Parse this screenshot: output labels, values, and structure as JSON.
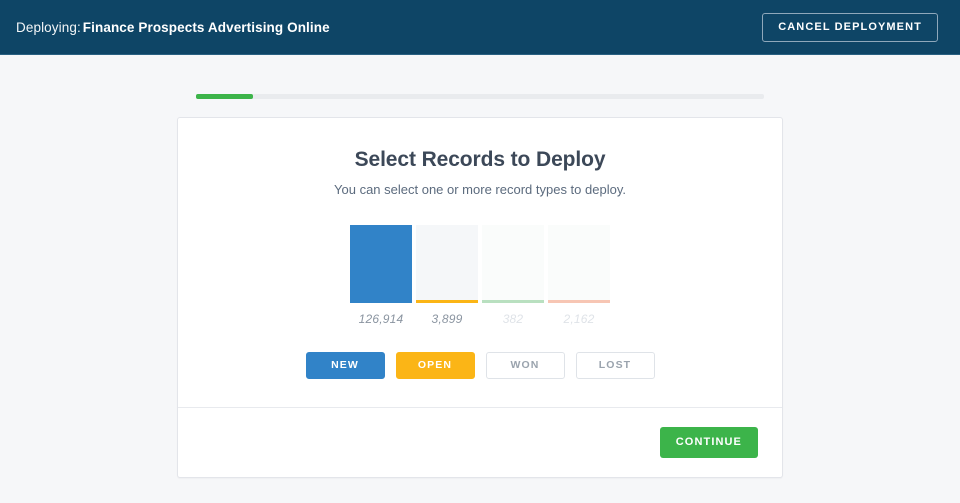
{
  "header": {
    "deploying_label": "Deploying:",
    "deployment_name": "Finance Prospects Advertising Online",
    "cancel_label": "CANCEL DEPLOYMENT",
    "background_color": "#0e4566"
  },
  "progress": {
    "percent": 10,
    "fill_color": "#3cb44a",
    "track_color": "#e9ebee"
  },
  "card": {
    "title": "Select Records to Deploy",
    "subtitle": "You can select one or more record types to deploy.",
    "continue_label": "CONTINUE",
    "continue_color": "#3cb44a"
  },
  "chart_data": {
    "type": "bar",
    "title": "Select Records to Deploy",
    "xlabel": "",
    "ylabel": "",
    "categories": [
      "NEW",
      "OPEN",
      "WON",
      "LOST"
    ],
    "values": [
      126914,
      3899,
      382,
      2162
    ],
    "value_labels": [
      "126,914",
      "3,899",
      "382",
      "2,162"
    ],
    "ylim": [
      0,
      126914
    ],
    "grid": false,
    "legend": "none",
    "bar_colors": [
      "#3183c8",
      "#fbb516",
      "#b9e0c0",
      "#f7c6b4"
    ],
    "bar_track_colors": [
      "#f5f7f9",
      "#f5f7f9",
      "#fafcfb",
      "#fafcfb"
    ],
    "selected": [
      true,
      true,
      false,
      false
    ]
  },
  "record_types": [
    {
      "label": "NEW",
      "count_label": "126,914",
      "selected": true,
      "state": "new-sel",
      "label_tone": "on"
    },
    {
      "label": "OPEN",
      "count_label": "3,899",
      "selected": true,
      "state": "open-sel",
      "label_tone": "on"
    },
    {
      "label": "WON",
      "count_label": "382",
      "selected": false,
      "state": "off",
      "label_tone": "dim"
    },
    {
      "label": "LOST",
      "count_label": "2,162",
      "selected": false,
      "state": "off",
      "label_tone": "dim"
    }
  ]
}
